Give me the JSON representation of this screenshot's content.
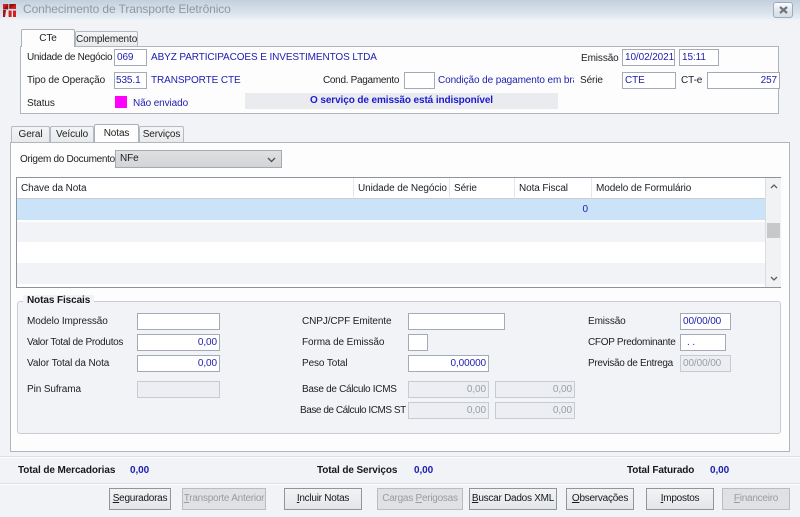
{
  "window": {
    "title": "Conhecimento de Transporte Eletrônico"
  },
  "icons": {
    "app": "protheus-logo",
    "close": "close-x",
    "combo_arrow": "chevron-down",
    "scroll_up": "chevron-up",
    "scroll_down": "chevron-down"
  },
  "colors": {
    "value_navy": "#1d1daf",
    "status_magenta": "#ff00ff",
    "banner_blue": "#1a1ad0",
    "selected_row": "#cbe3f8"
  },
  "tabs_main": [
    {
      "label": "CTe",
      "active": true
    },
    {
      "label": "Complemento",
      "active": false
    }
  ],
  "header": {
    "unidade_label": "Unidade de Negócio",
    "unidade_code": "069",
    "unidade_desc": "ABYZ PARTICIPACOES E INVESTIMENTOS LTDA",
    "tipo_label": "Tipo de Operação",
    "tipo_code": "535.1",
    "tipo_desc": "TRANSPORTE CTE",
    "cond_label": "Cond. Pagamento",
    "cond_value": "",
    "cond_desc": "Condição de pagamento em branco",
    "emissao_label": "Emissão",
    "emissao_date": "10/02/2021",
    "emissao_time": "15:11",
    "serie_label": "Série",
    "serie_value": "CTE",
    "cte_label": "CT-e",
    "cte_value": "257",
    "status_label": "Status",
    "status_text": "Não enviado",
    "status_banner": "O serviço de emissão está indisponível"
  },
  "tabs_sub": [
    {
      "label": "Geral",
      "active": false
    },
    {
      "label": "Veículo",
      "active": false
    },
    {
      "label": "Notas",
      "active": true
    },
    {
      "label": "Serviços",
      "active": false
    }
  ],
  "origem": {
    "label": "Origem do Documento",
    "value": "NFe"
  },
  "grid": {
    "columns": [
      "Chave da Nota",
      "Unidade de Negócio",
      "Série",
      "Nota Fiscal",
      "Modelo de Formulário"
    ],
    "selected_row_nota_fiscal": "0"
  },
  "notas_fiscais": {
    "title": "Notas Fiscais",
    "modelo_impressao": {
      "label": "Modelo Impressão",
      "value": ""
    },
    "valor_total_produtos": {
      "label": "Valor Total de Produtos",
      "value": "0,00"
    },
    "valor_total_nota": {
      "label": "Valor Total da Nota",
      "value": "0,00"
    },
    "pin_suframa": {
      "label": "Pin Suframa",
      "value": ""
    },
    "cnpj_emitente": {
      "label": "CNPJ/CPF Emitente",
      "value": ""
    },
    "forma_emissao": {
      "label": "Forma de Emissão",
      "value": ""
    },
    "peso_total": {
      "label": "Peso Total",
      "value": "0,00000"
    },
    "base_icms": {
      "label": "Base de Cálculo ICMS",
      "value1": "0,00",
      "value2": "0,00"
    },
    "base_icms_st": {
      "label": "Base de Cálculo ICMS ST",
      "value1": "0,00",
      "value2": "0,00"
    },
    "emissao": {
      "label": "Emissão",
      "value": "00/00/00"
    },
    "cfop": {
      "label": "CFOP Predominante",
      "value": ". ."
    },
    "previsao_entrega": {
      "label": "Previsão de Entrega",
      "value": "00/00/00"
    }
  },
  "totals": {
    "mercadorias": {
      "label": "Total de Mercadorias",
      "value": "0,00"
    },
    "servicos": {
      "label": "Total de Serviços",
      "value": "0,00"
    },
    "faturado": {
      "label": "Total Faturado",
      "value": "0,00"
    }
  },
  "buttons": [
    {
      "pre": "",
      "key": "S",
      "post": "eguradoras",
      "enabled": true
    },
    {
      "pre": "",
      "key": "T",
      "post": "ransporte Anterior",
      "enabled": false
    },
    {
      "pre": "",
      "key": "I",
      "post": "ncluir Notas",
      "enabled": true
    },
    {
      "pre": "Cargas ",
      "key": "P",
      "post": "erigosas",
      "enabled": false
    },
    {
      "pre": "",
      "key": "B",
      "post": "uscar Dados XML",
      "enabled": true
    },
    {
      "pre": "",
      "key": "O",
      "post": "bservações",
      "enabled": true
    },
    {
      "pre": "",
      "key": "I",
      "post": "mpostos",
      "enabled": true
    },
    {
      "pre": "",
      "key": "F",
      "post": "inanceiro",
      "enabled": false
    }
  ]
}
